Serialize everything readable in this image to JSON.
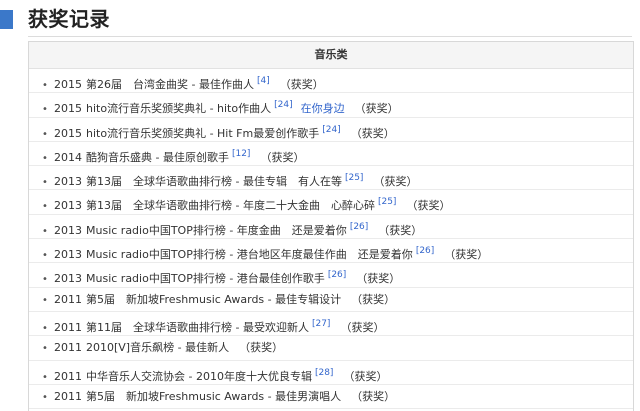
{
  "section": {
    "title": "获奖记录",
    "accent_color": "#3b78c9"
  },
  "table": {
    "header": "音乐类",
    "rows": [
      {
        "year": "2015",
        "award": "第26届　台湾金曲奖 - 最佳作曲人",
        "ref": "[4]",
        "link": "",
        "status": "（获奖）"
      },
      {
        "year": "2015",
        "award": "hito流行音乐奖颁奖典礼 - hito作曲人",
        "ref": "[24]",
        "link": "在你身边",
        "status": "（获奖）"
      },
      {
        "year": "2015",
        "award": "hito流行音乐奖颁奖典礼 - Hit Fm最爱创作歌手",
        "ref": "[24]",
        "link": "",
        "status": "（获奖）"
      },
      {
        "year": "2014",
        "award": "酷狗音乐盛典 - 最佳原创歌手",
        "ref": "[12]",
        "link": "",
        "status": "（获奖）"
      },
      {
        "year": "2013",
        "award": "第13届　全球华语歌曲排行榜 - 最佳专辑　有人在等",
        "ref": "[25]",
        "link": "",
        "status": "（获奖）"
      },
      {
        "year": "2013",
        "award": "第13届　全球华语歌曲排行榜 - 年度二十大金曲　心醉心碎",
        "ref": "[25]",
        "link": "",
        "status": "（获奖）"
      },
      {
        "year": "2013",
        "award": "Music radio中国TOP排行榜 - 年度金曲　还是爱着你",
        "ref": "[26]",
        "link": "",
        "status": "（获奖）"
      },
      {
        "year": "2013",
        "award": "Music radio中国TOP排行榜 - 港台地区年度最佳作曲　还是爱着你",
        "ref": "[26]",
        "link": "",
        "status": "（获奖）"
      },
      {
        "year": "2013",
        "award": "Music radio中国TOP排行榜 - 港台最佳创作歌手",
        "ref": "[26]",
        "link": "",
        "status": "（获奖）"
      },
      {
        "year": "2011",
        "award": "第5届　新加坡Freshmusic Awards - 最佳专辑设计",
        "ref": "",
        "link": "",
        "status": "（获奖）"
      },
      {
        "year": "2011",
        "award": "第11届　全球华语歌曲排行榜 - 最受欢迎新人",
        "ref": "[27]",
        "link": "",
        "status": "（获奖）"
      },
      {
        "year": "2011",
        "award": "2010[V]音乐飙榜 - 最佳新人",
        "ref": "",
        "link": "",
        "status": "（获奖）"
      },
      {
        "year": "2011",
        "award": "中华音乐人交流协会 - 2010年度十大优良专辑",
        "ref": "[28]",
        "link": "",
        "status": "（获奖）"
      },
      {
        "year": "2011",
        "award": "第5届　新加坡Freshmusic Awards - 最佳男演唱人",
        "ref": "",
        "link": "",
        "status": "（获奖）"
      }
    ]
  },
  "colors": {
    "link": "#3366cc",
    "text": "#333333",
    "header_bg": "#f5f5f5",
    "border": "#d8d8d8"
  }
}
